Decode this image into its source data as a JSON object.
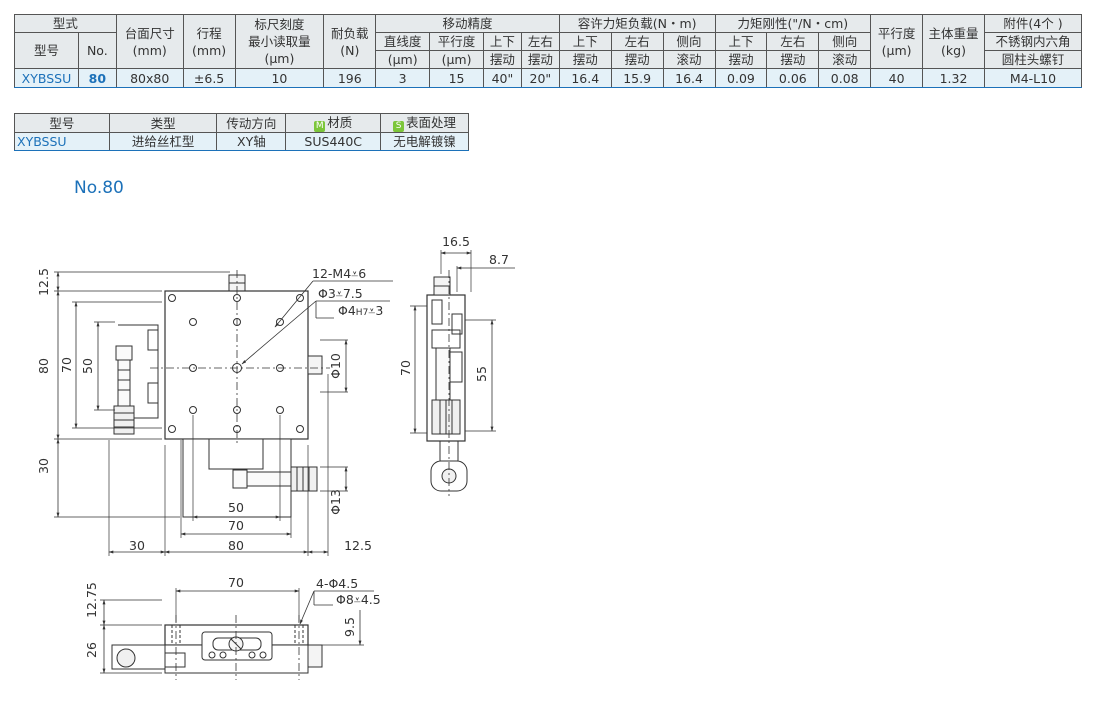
{
  "spec_table": {
    "group_model": "型式",
    "col_model": "型号",
    "col_no": "No.",
    "col_table_size": "台面尺寸",
    "col_table_size_unit": "(mm)",
    "col_stroke": "行程",
    "col_stroke_unit": "(mm)",
    "col_scale": "标尺刻度",
    "col_scale_sub": "最小读取量",
    "col_scale_unit": "(μm)",
    "col_load": "耐负载",
    "col_load_unit": "(N)",
    "group_accuracy": "移动精度",
    "col_straightness": "直线度",
    "col_straightness_unit": "(μm)",
    "col_parallelism": "平行度",
    "col_parallelism_unit": "(μm)",
    "col_pitch": "上下",
    "col_pitch_sub": "摆动",
    "col_yaw": "左右",
    "col_yaw_sub": "摆动",
    "group_moment": "容许力矩负载(N・m)",
    "col_m_pitch": "上下",
    "col_m_pitch_sub": "摆动",
    "col_m_yaw": "左右",
    "col_m_yaw_sub": "摆动",
    "col_m_roll": "侧向",
    "col_m_roll_sub": "滚动",
    "group_rigidity": "力矩刚性(\"/N・cm)",
    "col_r_pitch": "上下",
    "col_r_pitch_sub": "摆动",
    "col_r_yaw": "左右",
    "col_r_yaw_sub": "摆动",
    "col_r_roll": "侧向",
    "col_r_roll_sub": "滚动",
    "col_flatness": "平行度",
    "col_flatness_unit": "(μm)",
    "col_weight": "主体重量",
    "col_weight_unit": "(kg)",
    "group_accessory": "附件(4个 )",
    "col_accessory": "不锈钢内六角",
    "col_accessory_sub": "圆柱头螺钉",
    "row": {
      "model": "XYBSSU",
      "no": "80",
      "table_size": "80x80",
      "stroke": "±6.5",
      "scale": "10",
      "load": "196",
      "straightness": "3",
      "parallelism": "15",
      "pitch": "40\"",
      "yaw": "20\"",
      "m_pitch": "16.4",
      "m_yaw": "15.9",
      "m_roll": "16.4",
      "r_pitch": "0.09",
      "r_yaw": "0.06",
      "r_roll": "0.08",
      "flatness": "40",
      "weight": "1.32",
      "accessory": "M4-L10"
    }
  },
  "type_table": {
    "col_model": "型号",
    "col_type": "类型",
    "col_direction": "传动方向",
    "col_material_tag": "M",
    "col_material": "材质",
    "col_surface_tag": "S",
    "col_surface": "表面处理",
    "row": {
      "model": "XYBSSU",
      "type": "进给丝杠型",
      "direction": "XY轴",
      "material": "SUS440C",
      "surface": "无电解镀镍"
    }
  },
  "drawing": {
    "heading": "No.80",
    "dim_12_5_top": "12.5",
    "dim_80_v": "80",
    "dim_70_v": "70",
    "dim_50_v": "50",
    "dim_30_v": "30",
    "note_holes": "12-M4",
    "note_holes_depth": "6",
    "note_pin": "Φ3",
    "note_pin_depth": "7.5",
    "note_pin_hole": "Φ4",
    "note_pin_hole_tol": "H7",
    "note_pin_hole_depth": "3",
    "dim_phi10": "Φ10",
    "dim_phi13": "Φ13",
    "dim_50_h": "50",
    "dim_70_h": "70",
    "dim_30_h": "30",
    "dim_80_h": "80",
    "dim_12_5_h": "12.5",
    "side_16_5": "16.5",
    "side_8_7": "8.7",
    "side_70": "70",
    "side_55": "55",
    "front_70": "70",
    "front_12_75": "12.75",
    "front_26": "26",
    "front_9_5": "9.5",
    "front_holes": "4-Φ4.5",
    "front_cbore": "Φ8",
    "front_cbore_depth": "4.5"
  }
}
